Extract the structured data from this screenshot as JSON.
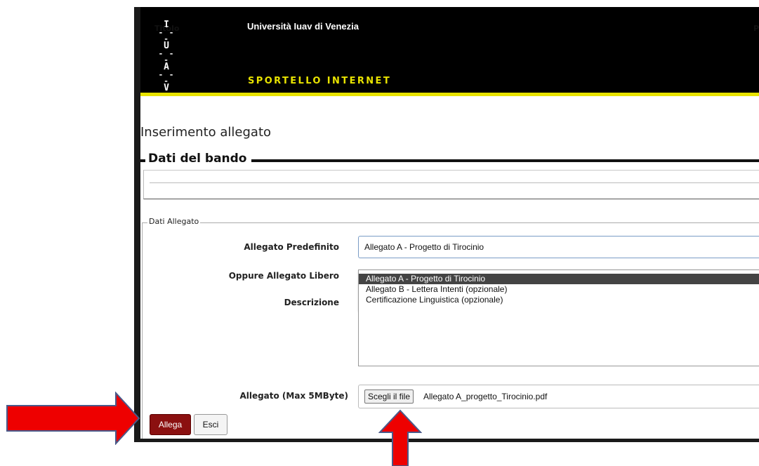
{
  "header": {
    "logo_letters": [
      "I",
      "U",
      "A",
      "V"
    ],
    "university": "Università Iuav di Venezia",
    "portal": "SPORTELLO INTERNET"
  },
  "page_title": "Inserimento allegato",
  "bando": {
    "section_title": "Dati del bando",
    "col_titolo": "Titolo",
    "col_partial": "P"
  },
  "allegato": {
    "legend": "Dati Allegato",
    "predefinito_label": "Allegato Predefinito",
    "predefinito_value": "Allegato A - Progetto di Tirocinio",
    "libero_label": "Oppure Allegato Libero",
    "descrizione_label": "Descrizione",
    "options": [
      "Allegato A - Progetto di Tirocinio",
      "Allegato B - Lettera Intenti (opzionale)",
      "Certificazione Linguistica (opzionale)"
    ],
    "file_label": "Allegato (Max 5MByte)",
    "file_button": "Scegli il file",
    "file_name": "Allegato A_progetto_Tirocinio.pdf"
  },
  "buttons": {
    "allega": "Allega",
    "esci": "Esci"
  },
  "colors": {
    "header_bg": "#000000",
    "accent_yellow": "#e8e300",
    "allega_button": "#8b1010",
    "annotation_arrow": "#ee0000"
  },
  "annotations": [
    "red-arrow-pointing-right-to-allega",
    "red-arrow-pointing-up-to-file-chooser"
  ]
}
